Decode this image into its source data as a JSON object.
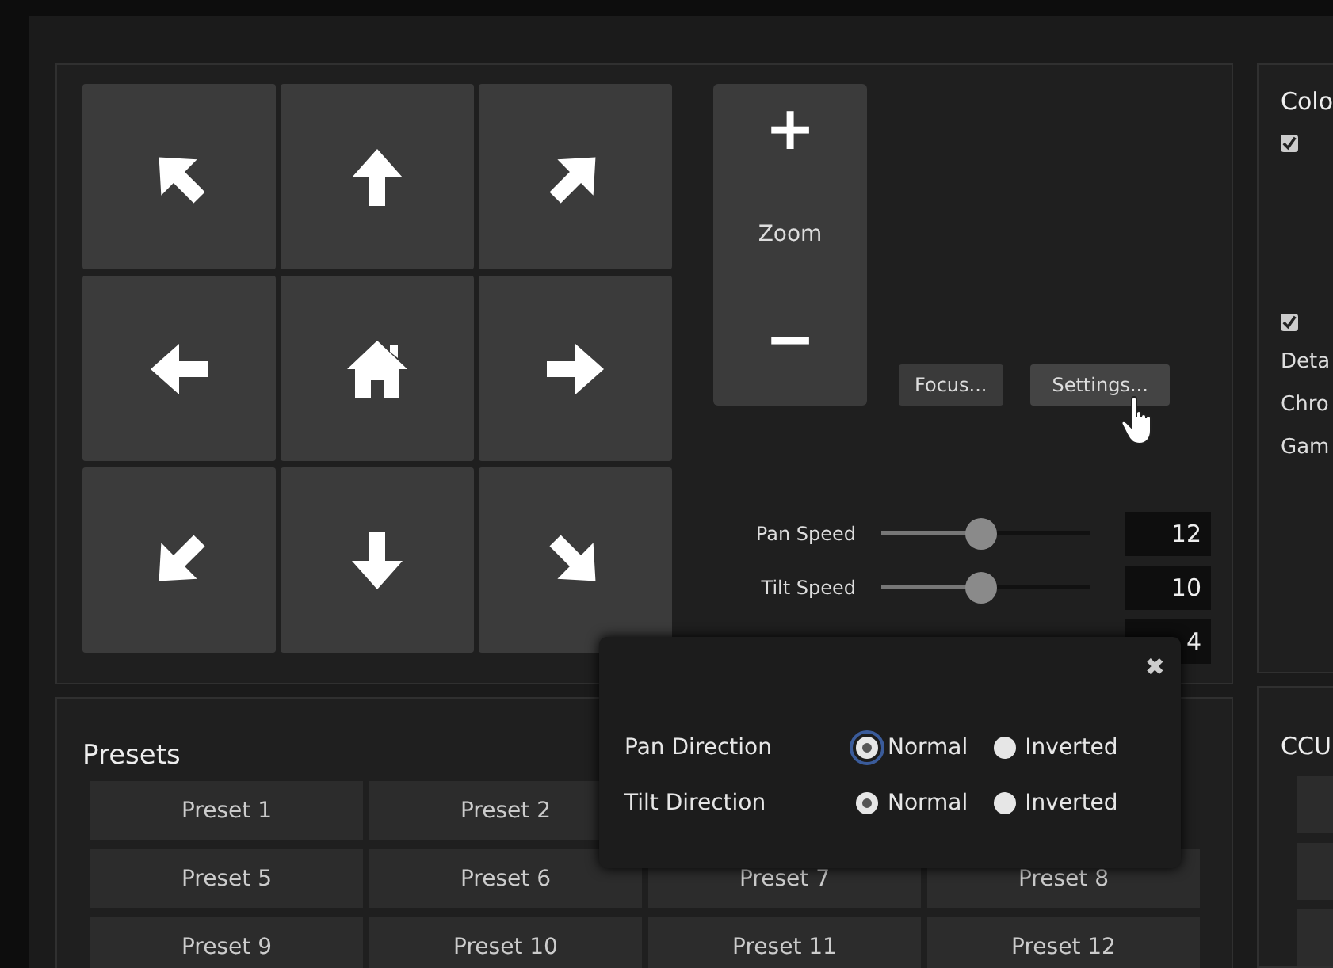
{
  "ptz": {
    "move_pad": [
      {
        "kind": "up-left"
      },
      {
        "kind": "up"
      },
      {
        "kind": "up-right"
      },
      {
        "kind": "left"
      },
      {
        "kind": "home"
      },
      {
        "kind": "right"
      },
      {
        "kind": "down-left"
      },
      {
        "kind": "down"
      },
      {
        "kind": "down-right"
      }
    ],
    "zoom": {
      "in": "+",
      "label": "Zoom",
      "out": "−"
    },
    "buttons": [
      "Focus...",
      "Settings..."
    ],
    "speeds": [
      {
        "label": "Pan Speed",
        "level": 0.48,
        "value": "12"
      },
      {
        "label": "Tilt Speed",
        "level": 0.48,
        "value": "10"
      },
      {
        "value": "4"
      }
    ]
  },
  "color_panel": {
    "title": "Colo",
    "checkboxes": [
      {
        "checked": true
      },
      {
        "checked": true
      }
    ],
    "labels": [
      "Deta",
      "Chro",
      "Gam"
    ]
  },
  "presets": {
    "title": "Presets",
    "rows": [
      [
        "Preset 1",
        "Preset 2"
      ],
      [
        "Preset 5",
        "Preset 6",
        "Preset 7",
        "Preset 8"
      ],
      [
        "Preset 9",
        "Preset 10",
        "Preset 11",
        "Preset 12"
      ]
    ]
  },
  "ccu_panel": {
    "title": "CCU"
  },
  "settings_popup": {
    "close": "✖",
    "rows": [
      {
        "label": "Pan Direction",
        "options": [
          {
            "label": "Normal",
            "selected": true,
            "focused": true
          },
          {
            "label": "Inverted",
            "selected": false,
            "focused": false
          }
        ]
      },
      {
        "label": "Tilt Direction",
        "options": [
          {
            "label": "Normal",
            "selected": true,
            "focused": false
          },
          {
            "label": "Inverted",
            "selected": false,
            "focused": false
          }
        ]
      }
    ]
  }
}
